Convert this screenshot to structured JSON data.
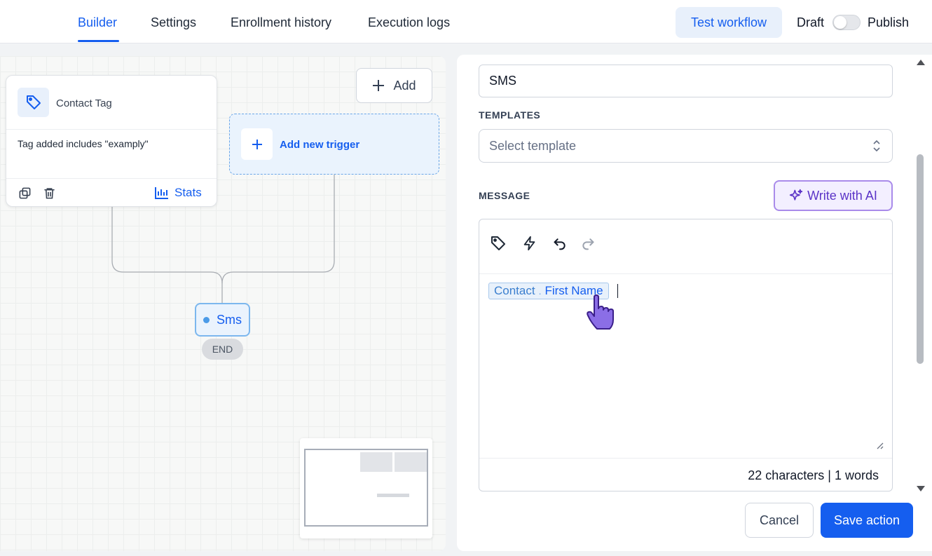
{
  "tabs": [
    {
      "label": "Builder",
      "active": true
    },
    {
      "label": "Settings"
    },
    {
      "label": "Enrollment history"
    },
    {
      "label": "Execution logs"
    }
  ],
  "header": {
    "test_workflow": "Test workflow",
    "draft": "Draft",
    "publish": "Publish",
    "published": false
  },
  "canvas": {
    "trigger": {
      "title": "Contact Tag",
      "description": "Tag added includes \"examply\"",
      "stats": "Stats",
      "icon": "tag-icon"
    },
    "add_button": "Add",
    "add_new_trigger": "Add new trigger",
    "action_node": "Sms",
    "end_label": "END"
  },
  "panel": {
    "action_name": "SMS",
    "templates_label": "TEMPLATES",
    "template_placeholder": "Select template",
    "message_label": "MESSAGE",
    "write_with_ai": "Write with AI",
    "chip": {
      "object": "Contact",
      "separator": ".",
      "field": "First Name"
    },
    "counter": "22 characters | 1 words",
    "cancel": "Cancel",
    "save": "Save action"
  },
  "colors": {
    "primary": "#155eef",
    "ai_purple": "#5b34c7",
    "node_blue": "#eaf3fd"
  }
}
